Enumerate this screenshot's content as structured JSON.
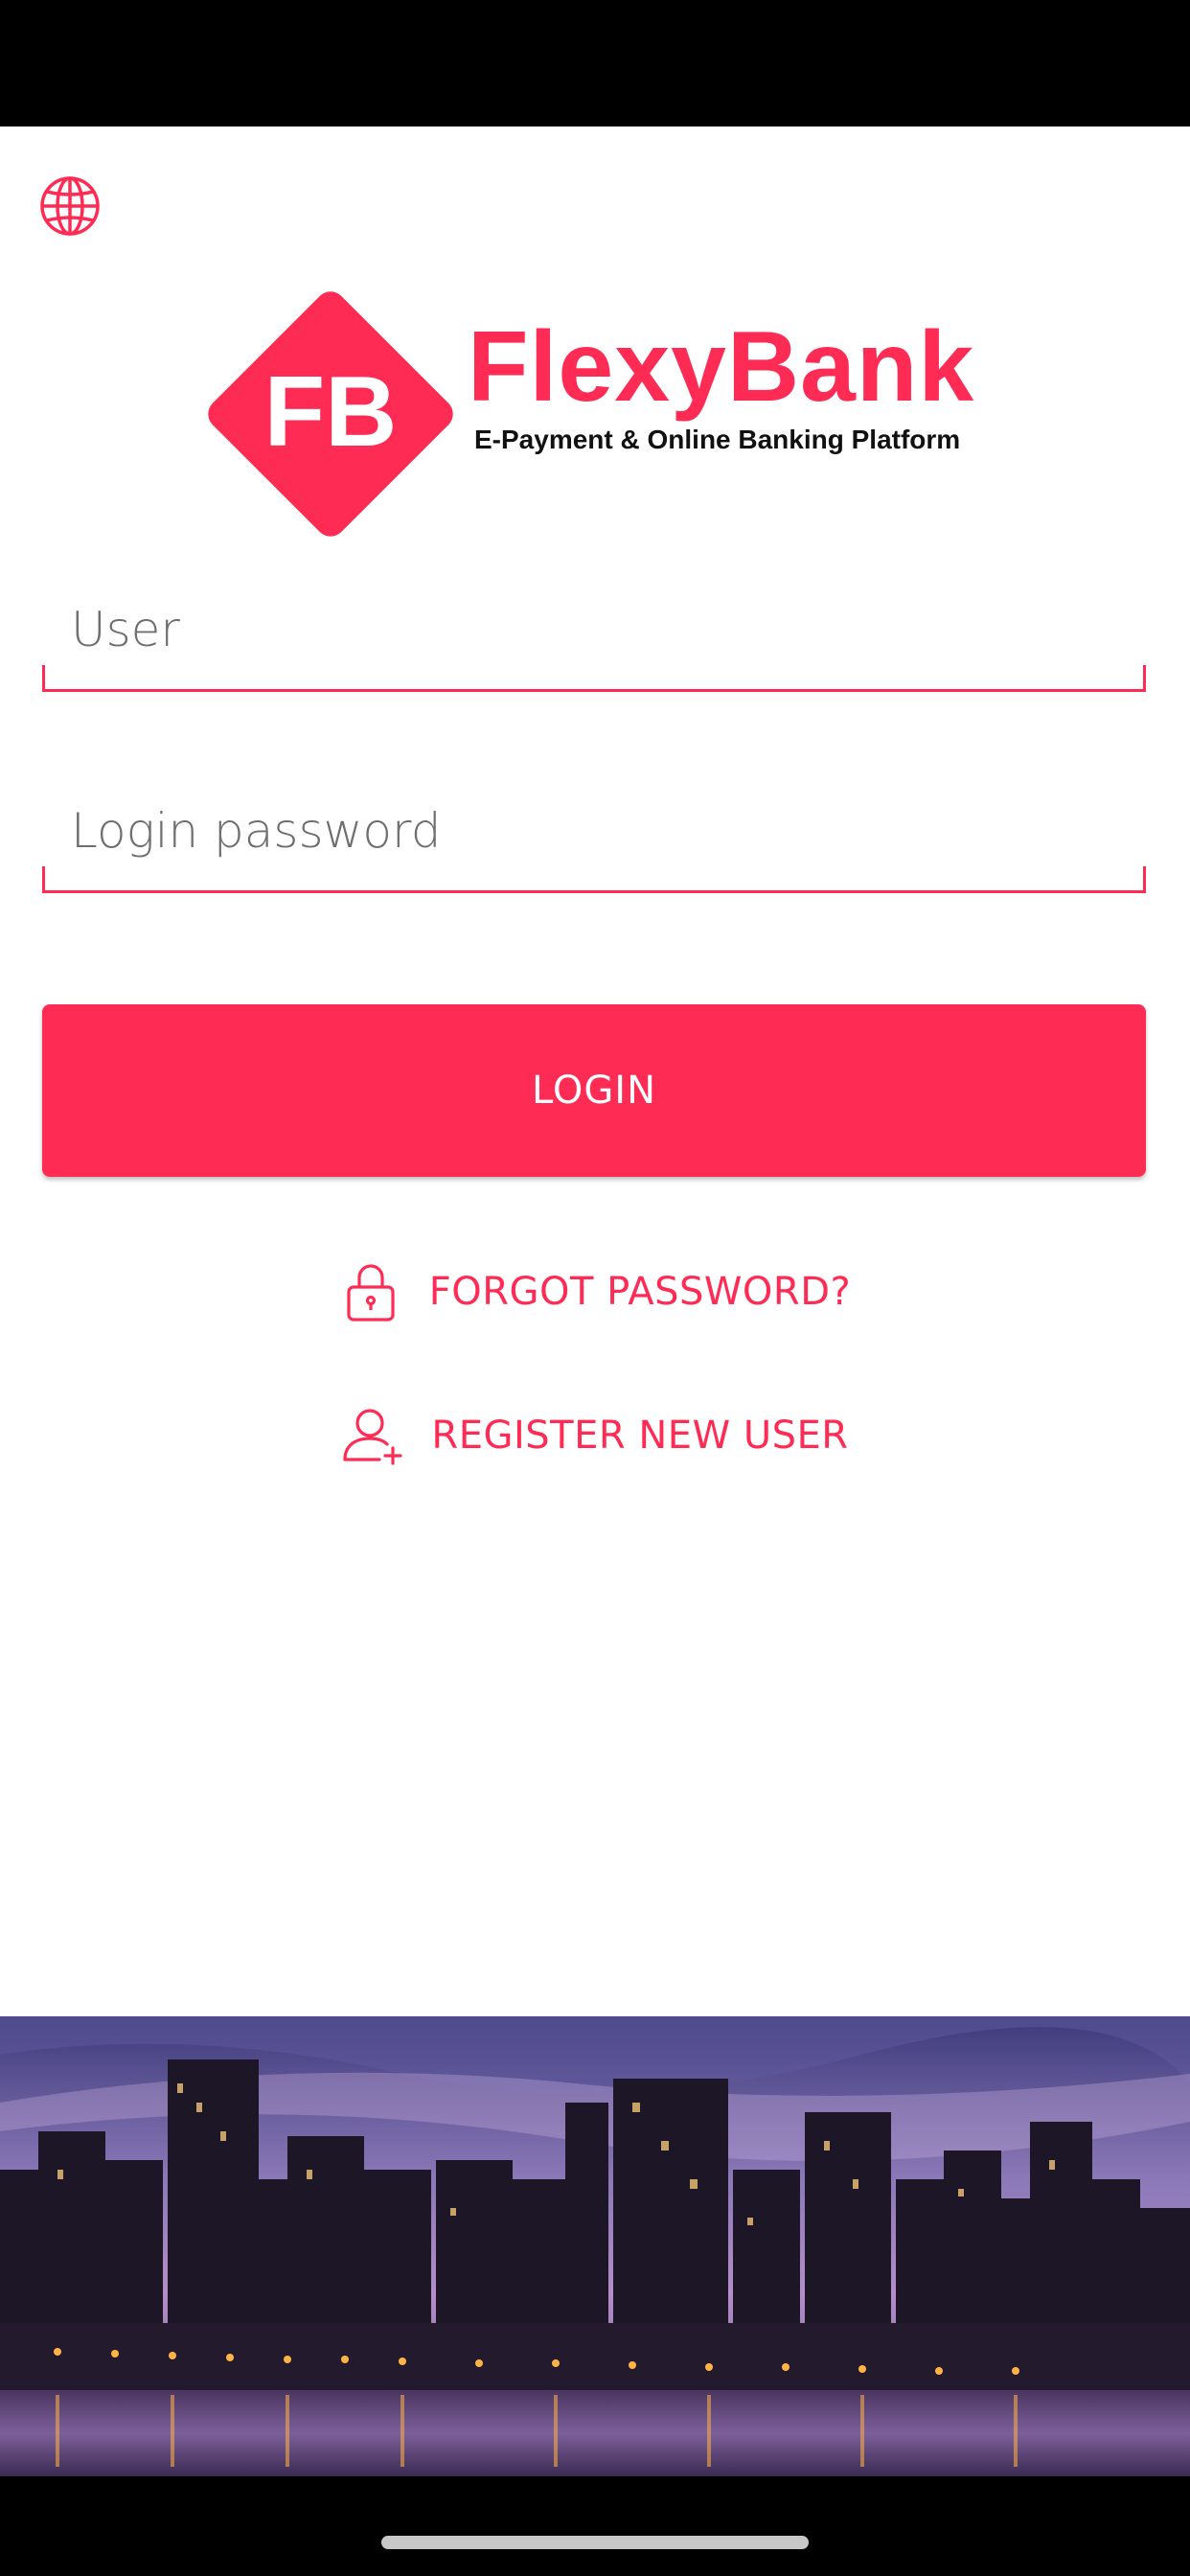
{
  "app": {
    "brand_initials": "FB",
    "brand_name": "FlexyBank",
    "tagline": "E-Payment & Online Banking Platform",
    "accent_color": "#fe2c55"
  },
  "form": {
    "user_placeholder": "User",
    "password_placeholder": "Login password",
    "login_label": "LOGIN"
  },
  "links": {
    "forgot_password": "FORGOT PASSWORD?",
    "register": "REGISTER NEW USER"
  },
  "icons": {
    "language": "globe-icon",
    "forgot": "lock-icon",
    "register": "user-add-icon"
  }
}
